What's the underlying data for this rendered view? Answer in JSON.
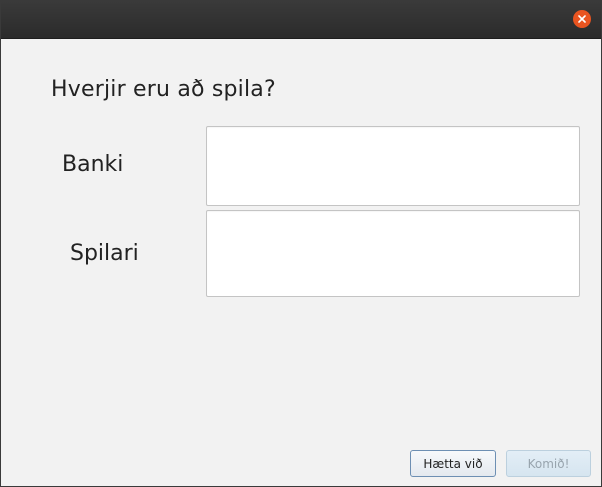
{
  "dialog": {
    "prompt": "Hverjir eru að spila?",
    "fields": [
      {
        "label": "Banki",
        "value": ""
      },
      {
        "label": "Spilari",
        "value": ""
      }
    ],
    "buttons": {
      "cancel_label": "Hætta við",
      "ok_label": "Komið!",
      "ok_enabled": false
    }
  },
  "colors": {
    "titlebar": "#2b2b2b",
    "close_button": "#e95420",
    "background": "#f2f2f2",
    "focus_border": "#6d8fb3"
  },
  "icons": {
    "close": "close-icon"
  }
}
